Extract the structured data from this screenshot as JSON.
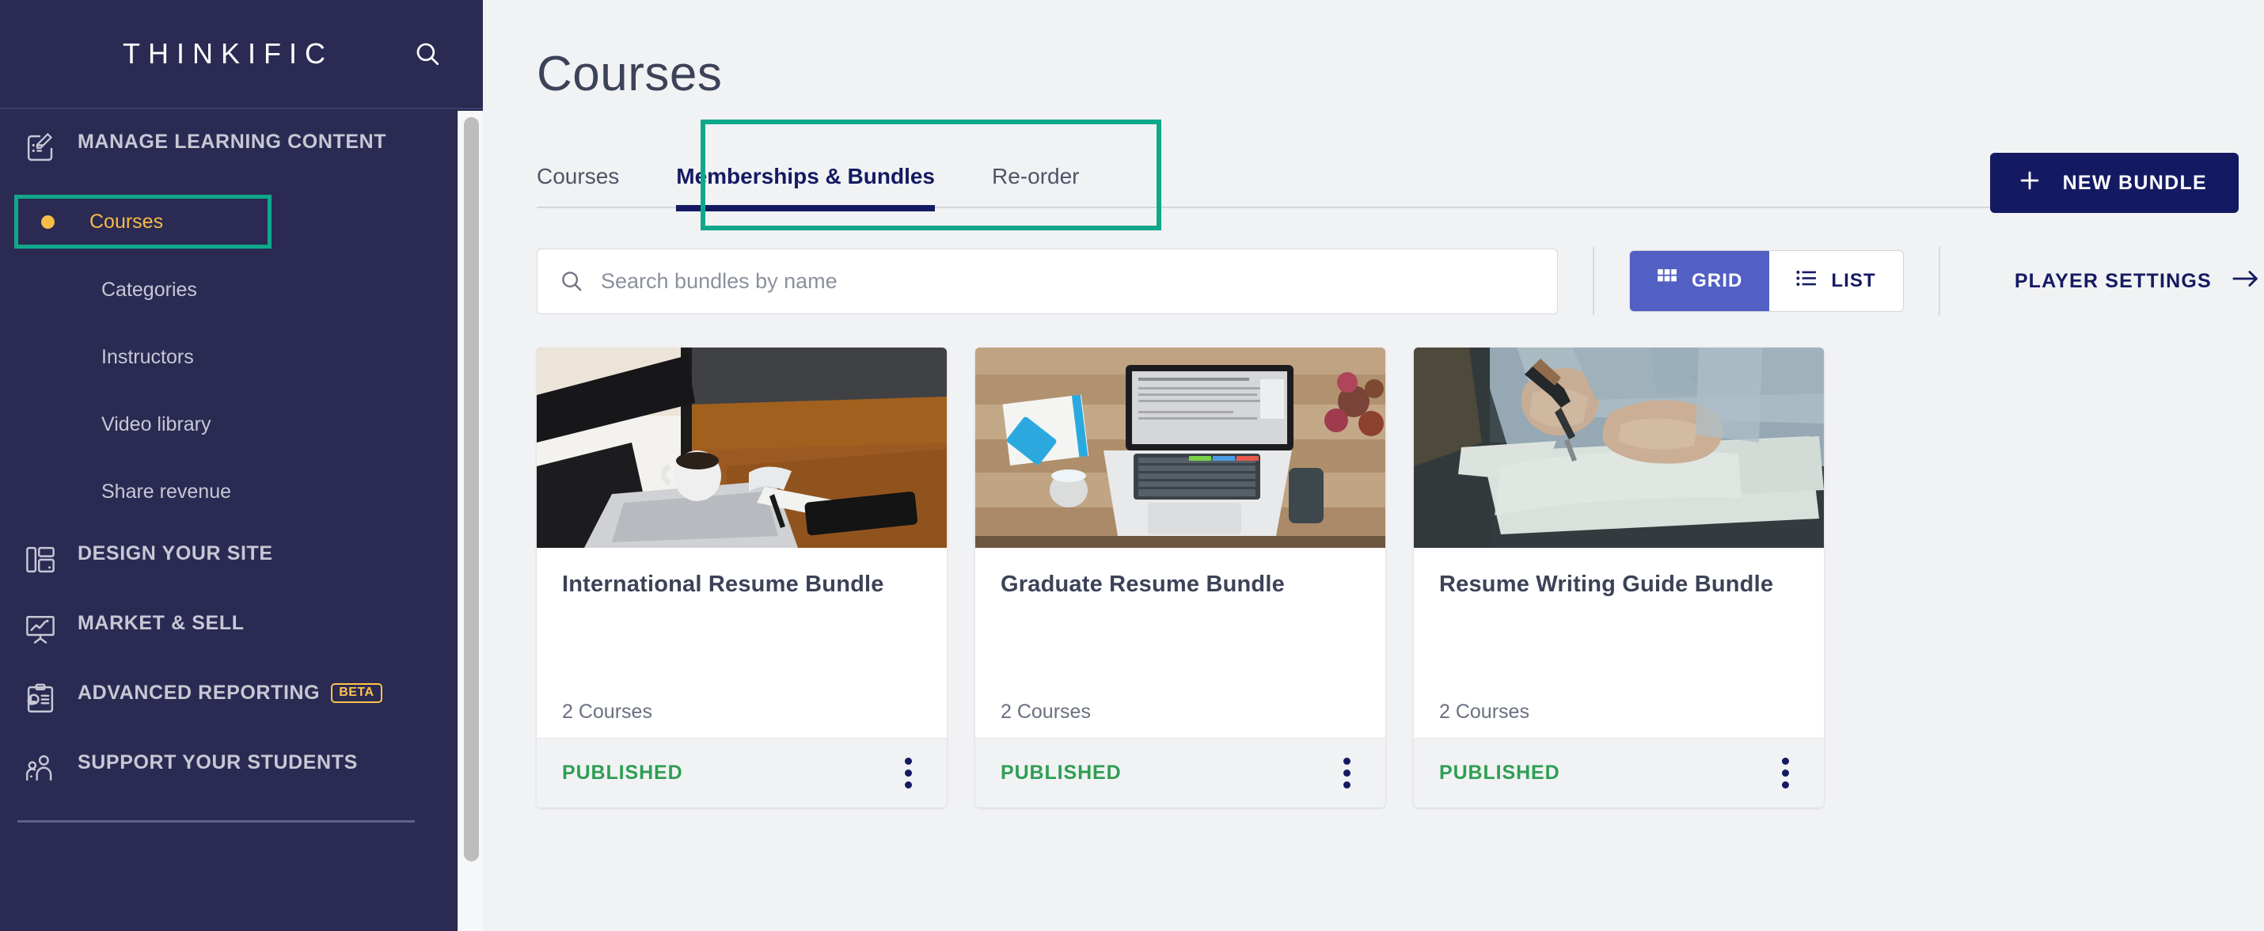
{
  "brand": {
    "name": "THINKIFIC",
    "search_icon": "search-icon"
  },
  "sidebar": {
    "sections": [
      {
        "id": "manage-learning-content",
        "label": "MANAGE LEARNING CONTENT",
        "icon": "edit-document-icon"
      },
      {
        "id": "design-your-site",
        "label": "DESIGN YOUR SITE",
        "icon": "layout-icon"
      },
      {
        "id": "market-and-sell",
        "label": "MARKET & SELL",
        "icon": "presentation-chart-icon"
      },
      {
        "id": "advanced-reporting",
        "label": "ADVANCED REPORTING",
        "icon": "clipboard-chart-icon",
        "badge": "BETA"
      },
      {
        "id": "support-your-students",
        "label": "SUPPORT YOUR STUDENTS",
        "icon": "people-icon"
      }
    ],
    "sub_items": [
      {
        "id": "courses",
        "label": "Courses",
        "active": true
      },
      {
        "id": "categories",
        "label": "Categories",
        "active": false
      },
      {
        "id": "instructors",
        "label": "Instructors",
        "active": false
      },
      {
        "id": "video-library",
        "label": "Video library",
        "active": false
      },
      {
        "id": "share-revenue",
        "label": "Share revenue",
        "active": false
      }
    ]
  },
  "main": {
    "page_title": "Courses",
    "tabs": [
      {
        "id": "courses",
        "label": "Courses",
        "active": false
      },
      {
        "id": "memberships-bundles",
        "label": "Memberships & Bundles",
        "active": true
      },
      {
        "id": "reorder",
        "label": "Re-order",
        "active": false
      }
    ],
    "search": {
      "placeholder": "Search bundles by name",
      "value": "",
      "icon": "search-icon"
    },
    "view_toggle": [
      {
        "id": "grid",
        "label": "GRID",
        "icon": "grid-icon",
        "active": true
      },
      {
        "id": "list",
        "label": "LIST",
        "icon": "list-icon",
        "active": false
      }
    ],
    "player_settings": {
      "label": "PLAYER SETTINGS",
      "icon": "arrow-right-icon"
    },
    "new_bundle": {
      "label": "NEW BUNDLE",
      "icon": "plus-icon"
    },
    "cards": [
      {
        "title": "International Resume Bundle",
        "count": "2 Courses",
        "status": "PUBLISHED",
        "image": "desk-laptop-coffee-photo",
        "menu_icon": "kebab-menu-icon"
      },
      {
        "title": "Graduate Resume Bundle",
        "count": "2 Courses",
        "status": "PUBLISHED",
        "image": "overhead-laptop-notebook-photo",
        "menu_icon": "kebab-menu-icon"
      },
      {
        "title": "Resume Writing Guide Bundle",
        "count": "2 Courses",
        "status": "PUBLISHED",
        "image": "hand-writing-paper-photo",
        "menu_icon": "kebab-menu-icon"
      }
    ]
  },
  "annotations": {
    "highlight_color": "#0fa88b",
    "arrow_color": "#0fa88b",
    "highlighted_sidebar_item": "Courses",
    "highlighted_tab": "Memberships & Bundles",
    "arrow_points_to": "NEW BUNDLE"
  },
  "colors": {
    "sidebar_bg": "#2a2a53",
    "accent_yellow": "#f7bc46",
    "navy": "#141a62",
    "periwinkle": "#5260c4",
    "published_green": "#2f9e53",
    "page_bg": "#f1f2f4"
  }
}
